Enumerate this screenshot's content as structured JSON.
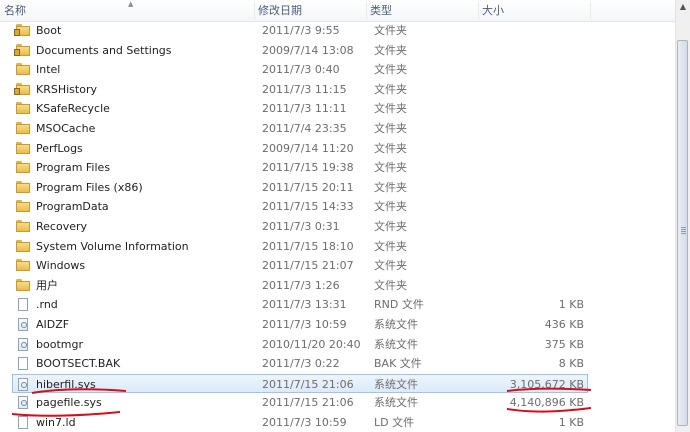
{
  "header": {
    "name": "名称",
    "date": "修改日期",
    "type": "类型",
    "size": "大小"
  },
  "rows": [
    {
      "name": "Boot",
      "date": "2011/7/3 9:55",
      "type": "文件夹",
      "size": "",
      "icon": "folder-lock-icon"
    },
    {
      "name": "Documents and Settings",
      "date": "2009/7/14 13:08",
      "type": "文件夹",
      "size": "",
      "icon": "folder-lock-icon"
    },
    {
      "name": "Intel",
      "date": "2011/7/3 0:40",
      "type": "文件夹",
      "size": "",
      "icon": "folder-icon"
    },
    {
      "name": "KRSHistory",
      "date": "2011/7/3 11:15",
      "type": "文件夹",
      "size": "",
      "icon": "folder-lock-icon"
    },
    {
      "name": "KSafeRecycle",
      "date": "2011/7/3 11:11",
      "type": "文件夹",
      "size": "",
      "icon": "folder-icon"
    },
    {
      "name": "MSOCache",
      "date": "2011/7/4 23:35",
      "type": "文件夹",
      "size": "",
      "icon": "folder-icon"
    },
    {
      "name": "PerfLogs",
      "date": "2009/7/14 11:20",
      "type": "文件夹",
      "size": "",
      "icon": "folder-icon"
    },
    {
      "name": "Program Files",
      "date": "2011/7/15 19:38",
      "type": "文件夹",
      "size": "",
      "icon": "folder-icon"
    },
    {
      "name": "Program Files (x86)",
      "date": "2011/7/15 20:11",
      "type": "文件夹",
      "size": "",
      "icon": "folder-icon"
    },
    {
      "name": "ProgramData",
      "date": "2011/7/15 14:33",
      "type": "文件夹",
      "size": "",
      "icon": "folder-icon"
    },
    {
      "name": "Recovery",
      "date": "2011/7/3 0:31",
      "type": "文件夹",
      "size": "",
      "icon": "folder-icon"
    },
    {
      "name": "System Volume Information",
      "date": "2011/7/15 18:10",
      "type": "文件夹",
      "size": "",
      "icon": "folder-icon"
    },
    {
      "name": "Windows",
      "date": "2011/7/15 21:07",
      "type": "文件夹",
      "size": "",
      "icon": "folder-icon"
    },
    {
      "name": "用户",
      "date": "2011/7/3 1:26",
      "type": "文件夹",
      "size": "",
      "icon": "folder-icon"
    },
    {
      "name": ".rnd",
      "date": "2011/7/3 13:31",
      "type": "RND 文件",
      "size": "1 KB",
      "icon": "file-icon"
    },
    {
      "name": "AIDZF",
      "date": "2011/7/3 10:59",
      "type": "系统文件",
      "size": "436 KB",
      "icon": "system-file-icon"
    },
    {
      "name": "bootmgr",
      "date": "2010/11/20 20:40",
      "type": "系统文件",
      "size": "375 KB",
      "icon": "system-file-icon"
    },
    {
      "name": "BOOTSECT.BAK",
      "date": "2011/7/3 0:22",
      "type": "BAK 文件",
      "size": "8 KB",
      "icon": "file-icon"
    },
    {
      "name": "hiberfil.sys",
      "date": "2011/7/15 21:06",
      "type": "系统文件",
      "size": "3,105,672 KB",
      "icon": "system-file-icon",
      "selected": true
    },
    {
      "name": "pagefile.sys",
      "date": "2011/7/15 21:06",
      "type": "系统文件",
      "size": "4,140,896 KB",
      "icon": "system-file-icon"
    },
    {
      "name": "win7.ld",
      "date": "2011/7/3 10:59",
      "type": "LD 文件",
      "size": "1 KB",
      "icon": "file-icon"
    }
  ],
  "colors": {
    "selection_fill": "#dbeaf9",
    "selection_border": "#9ec3e6",
    "annotation_red": "#d10f1f",
    "header_text": "#4c607a"
  }
}
